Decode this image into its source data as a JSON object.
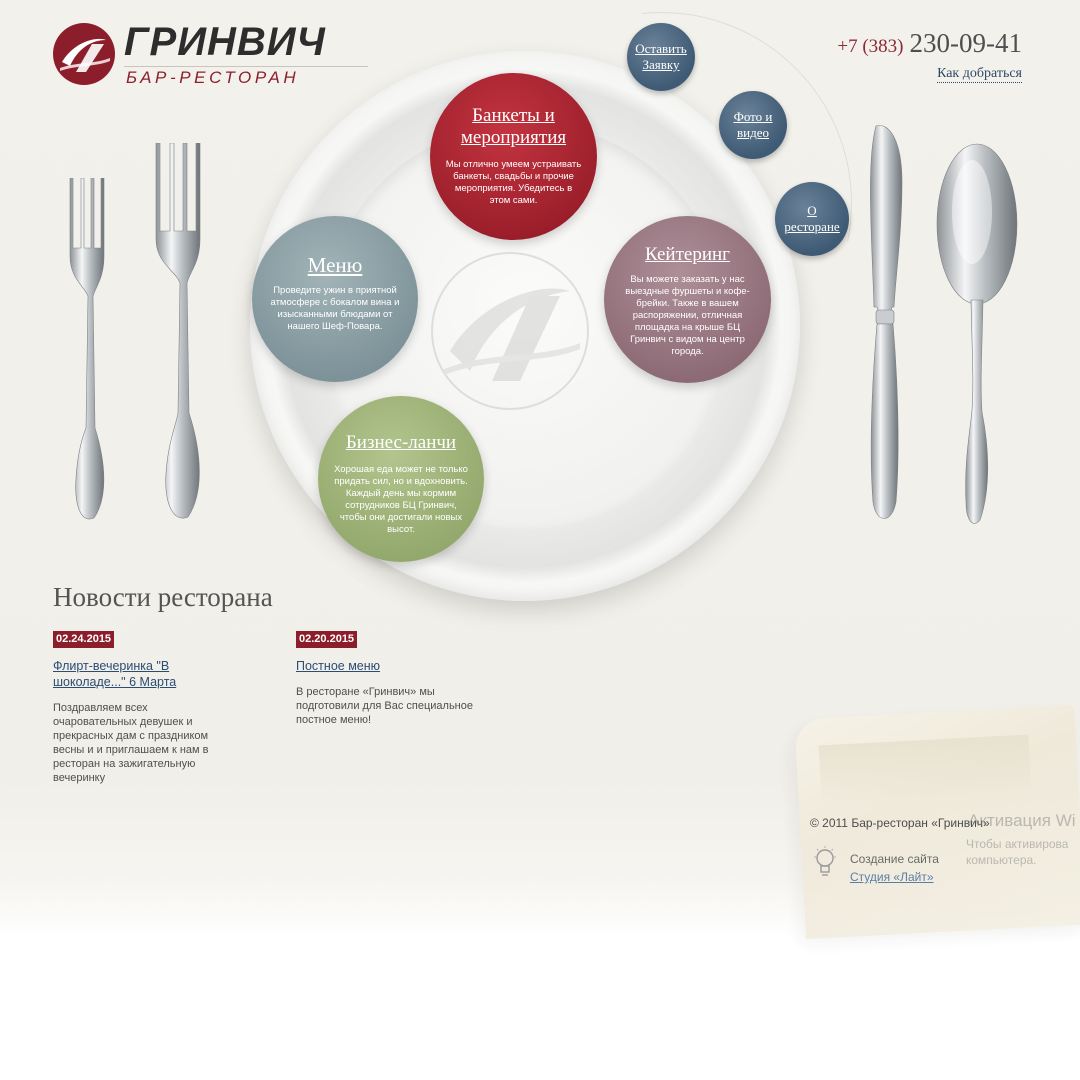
{
  "brand": {
    "name": "ГРИНВИЧ",
    "subtitle": "БАР-РЕСТОРАН"
  },
  "contact": {
    "phone_code": "+7 (383)",
    "phone_number": "230-09-41",
    "directions_link": "Как добраться"
  },
  "mini_nav": {
    "request": [
      "Оставить",
      "Заявку"
    ],
    "photo": [
      "Фото и",
      "видео"
    ],
    "about": [
      "О",
      "ресторане"
    ]
  },
  "services": {
    "banquets": {
      "title_lines": [
        "Банкеты и",
        "мероприятия"
      ],
      "description": "Мы отлично умеем устраивать банкеты, свадьбы и прочие мероприятия. Убедитесь в этом сами."
    },
    "menu": {
      "title": "Меню",
      "description": "Проведите ужин в приятной атмосфере с бокалом вина и изысканными блюдами от нашего Шеф-Повара."
    },
    "catering": {
      "title": "Кейтеринг",
      "description": "Вы можете заказать у нас выездные фуршеты и кофе-брейки. Также в вашем распоряжении, отличная площадка на крыше БЦ Гринвич с видом на центр города."
    },
    "business_lunch": {
      "title": "Бизнес-ланчи",
      "description": "Хорошая еда может не только придать сил, но и вдохновить. Каждый день мы кормим сотрудников БЦ Гринвич, чтобы они достигали новых высот."
    }
  },
  "news": {
    "heading": "Новости ресторана",
    "items": [
      {
        "date": "02.24.2015",
        "title": "Флирт-вечеринка \"В шоколаде...\" 6 Марта",
        "text": "Поздравляем всех очаровательных девушек и прекрасных дам с праздником весны и и приглашаем к нам в ресторан на зажигательную вечеринку"
      },
      {
        "date": "02.20.2015",
        "title": "Постное меню",
        "text": "В ресторане «Гринвич» мы подготовили для Вас специальное постное меню!"
      }
    ]
  },
  "footer": {
    "copyright": "© 2011 Бар-ресторан «Гринвич»",
    "studio_label": "Создание сайта",
    "studio_link": "Студия «Лайт»"
  },
  "os_watermark": {
    "title": "Активация Wi",
    "line1": "Чтобы активирова",
    "line2": "компьютера."
  },
  "colors": {
    "brand_red": "#8c1e2c",
    "navy": "#3f5a74",
    "banquets": "#a8232f",
    "menu": "#8aa0a5",
    "catering": "#9a7883",
    "business_lunch": "#a1b67c",
    "link": "#2c4d72"
  },
  "icons": {
    "logo": "brand-logo-icon",
    "bulb": "lightbulb-icon"
  }
}
